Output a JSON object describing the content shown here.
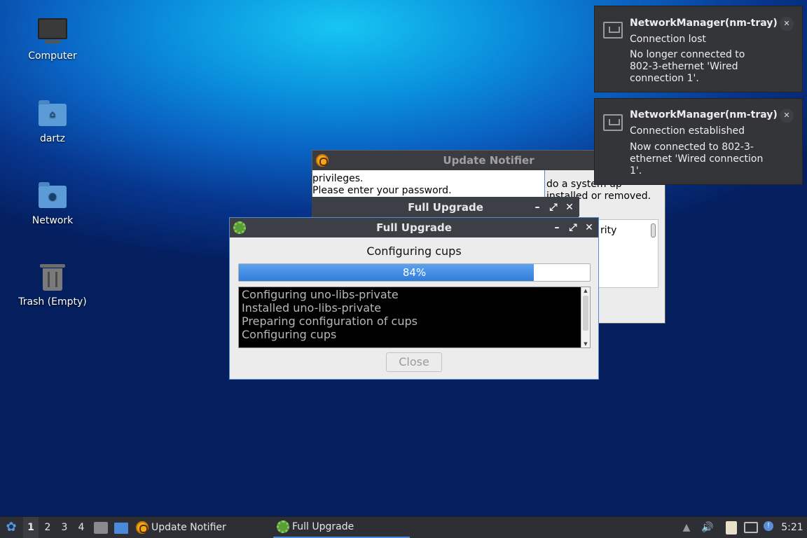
{
  "desktop_icons": [
    {
      "label": "Computer",
      "icon": "computer-icon"
    },
    {
      "label": "dartz",
      "icon": "home-folder-icon"
    },
    {
      "label": "Network",
      "icon": "network-folder-icon"
    },
    {
      "label": "Trash (Empty)",
      "icon": "trash-icon"
    }
  ],
  "update_notifier": {
    "title": "Update Notifier",
    "left_text_1": "privileges.",
    "left_text_2": "Please enter your password.",
    "right_text_1": "do a system up",
    "right_text_2": "installed or removed.",
    "list_fragment": "rity"
  },
  "full_upgrade_back": {
    "title": "Full Upgrade"
  },
  "full_upgrade": {
    "title": "Full Upgrade",
    "status": "Configuring cups",
    "progress_percent": 84,
    "progress_text": "84%",
    "log": [
      "Configuring uno-libs-private",
      "Installed uno-libs-private",
      "Preparing configuration of cups",
      "Configuring cups"
    ],
    "close_label": "Close"
  },
  "notifications": [
    {
      "title": "NetworkManager(nm-tray)",
      "summary": "Connection lost",
      "body": "No longer connected to 802-3-ethernet 'Wired connection 1'."
    },
    {
      "title": "NetworkManager(nm-tray)",
      "summary": "Connection established",
      "body": "Now connected to 802-3-ethernet 'Wired connection 1'."
    }
  ],
  "taskbar": {
    "workspaces": [
      "1",
      "2",
      "3",
      "4"
    ],
    "active_workspace": "1",
    "tasks": [
      {
        "label": "Update Notifier",
        "icon": "update-notifier-icon"
      },
      {
        "label": "Full Upgrade",
        "icon": "upgrade-gear-icon"
      }
    ],
    "clock": "5:21"
  },
  "colors": {
    "accent": "#4a8ad8",
    "progress_fill": "#3584e4",
    "titlebar": "#3c3f46"
  }
}
